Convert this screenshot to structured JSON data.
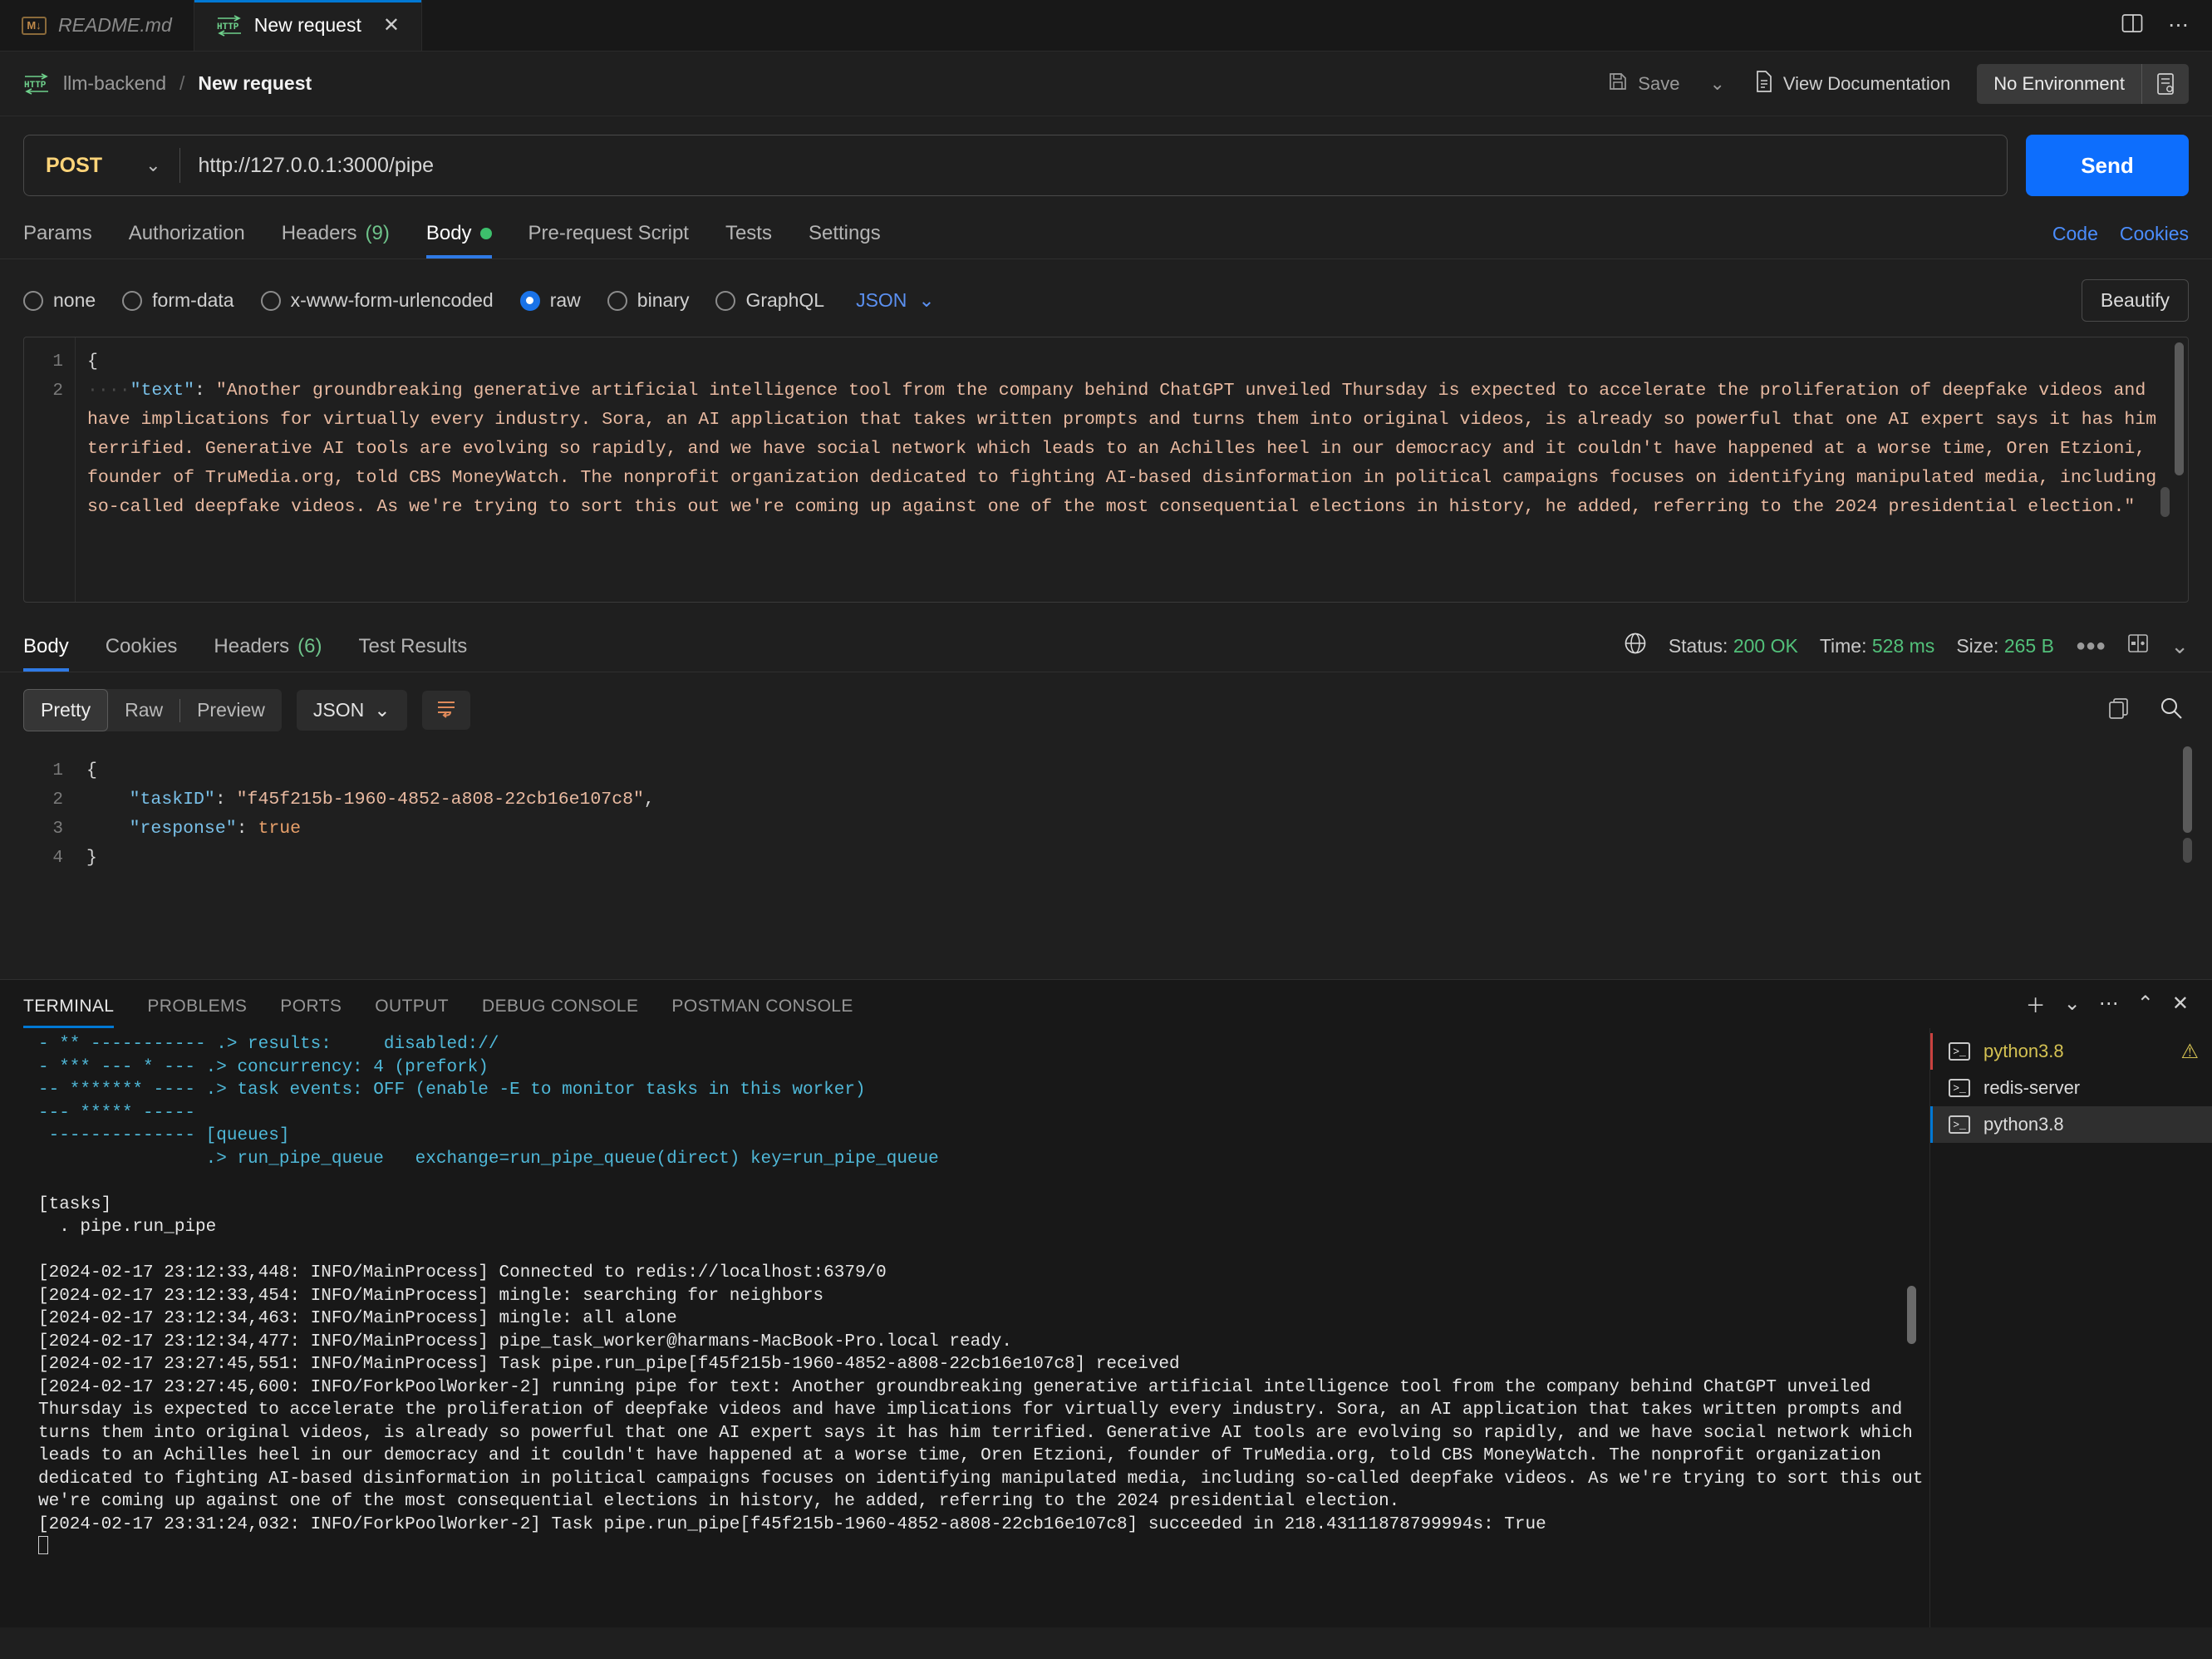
{
  "tabs": [
    {
      "label": "README.md",
      "icon": "markdown-icon",
      "active": false
    },
    {
      "label": "New request",
      "icon": "http-icon",
      "active": true,
      "close": "✕"
    }
  ],
  "titlebar_right": {
    "split_icon": "split-editor-icon",
    "more_icon": "ellipsis-icon"
  },
  "postman": {
    "breadcrumb": {
      "collection": "llm-backend",
      "separator": "/",
      "current": "New request",
      "icon": "http-icon"
    },
    "save_label": "Save",
    "save_chevron": "⌄",
    "view_docs_label": "View Documentation",
    "environment": "No Environment",
    "env_icon": "environment-quick-look-icon",
    "save_icon": "floppy-disk-icon",
    "docs_icon": "document-icon"
  },
  "request": {
    "method": "POST",
    "method_chevron": "⌄",
    "url": "http://127.0.0.1:3000/pipe",
    "send_label": "Send",
    "tabs": [
      {
        "label": "Params",
        "active": false
      },
      {
        "label": "Authorization",
        "active": false
      },
      {
        "label": "Headers",
        "count": "(9)",
        "active": false
      },
      {
        "label": "Body",
        "active": true,
        "dot": true
      },
      {
        "label": "Pre-request Script",
        "active": false
      },
      {
        "label": "Tests",
        "active": false
      },
      {
        "label": "Settings",
        "active": false
      }
    ],
    "right_links": [
      "Code",
      "Cookies"
    ],
    "body_types": [
      {
        "label": "none",
        "selected": false
      },
      {
        "label": "form-data",
        "selected": false
      },
      {
        "label": "x-www-form-urlencoded",
        "selected": false
      },
      {
        "label": "raw",
        "selected": true
      },
      {
        "label": "binary",
        "selected": false
      },
      {
        "label": "GraphQL",
        "selected": false
      }
    ],
    "raw_format": "JSON",
    "raw_format_chevron": "⌄",
    "beautify_label": "Beautify",
    "body_line_numbers": [
      "1",
      "2"
    ],
    "body_open_brace": "{",
    "body_indent": "····",
    "body_key": "\"text\"",
    "body_colon": ": ",
    "body_value": "\"Another groundbreaking generative artificial intelligence tool from the company behind ChatGPT unveiled Thursday is expected to accelerate the proliferation of deepfake videos and have implications for virtually every industry. Sora, an AI application that takes written prompts and turns them into original videos, is already so powerful that one AI expert says it has him terrified. Generative AI tools are evolving so rapidly, and we have social network which leads to an Achilles heel in our democracy and it couldn't have happened at a worse time, Oren Etzioni, founder of TruMedia.org, told CBS MoneyWatch. The nonprofit organization dedicated to fighting AI-based disinformation in political campaigns focuses on identifying manipulated media, including so-called deepfake videos. As we're trying to sort this out we're coming up against one of the most consequential elections in history, he added, referring to the 2024 presidential election.\""
  },
  "response": {
    "tabs": [
      {
        "label": "Body",
        "active": true
      },
      {
        "label": "Cookies",
        "active": false
      },
      {
        "label": "Headers",
        "count": "(6)",
        "active": false
      },
      {
        "label": "Test Results",
        "active": false
      }
    ],
    "globe_icon": "globe-icon",
    "status_label": "Status:",
    "status_value": "200 OK",
    "time_label": "Time:",
    "time_value": "528 ms",
    "size_label": "Size:",
    "size_value": "265 B",
    "more_icon": "ellipsis-icon",
    "layout_icon": "split-pane-icon",
    "collapse_icon": "chevron-down-icon",
    "view_modes": [
      "Pretty",
      "Raw",
      "Preview"
    ],
    "active_view_mode": "Pretty",
    "format": "JSON",
    "format_chevron": "⌄",
    "wrap_icon": "word-wrap-icon",
    "copy_icon": "copy-icon",
    "search_icon": "search-icon",
    "line_numbers": [
      "1",
      "2",
      "3",
      "4"
    ],
    "json": {
      "open": "{",
      "close": "}",
      "rows": [
        {
          "key": "\"taskID\"",
          "sep": ": ",
          "value": "\"f45f215b-1960-4852-a808-22cb16e107c8\"",
          "type": "string",
          "comma": ","
        },
        {
          "key": "\"response\"",
          "sep": ": ",
          "value": "true",
          "type": "bool",
          "comma": ""
        }
      ]
    }
  },
  "panel": {
    "tabs": [
      {
        "label": "TERMINAL",
        "active": true
      },
      {
        "label": "PROBLEMS",
        "active": false
      },
      {
        "label": "PORTS",
        "active": false
      },
      {
        "label": "OUTPUT",
        "active": false
      },
      {
        "label": "DEBUG CONSOLE",
        "active": false
      },
      {
        "label": "POSTMAN CONSOLE",
        "active": false
      }
    ],
    "actions": [
      {
        "icon": "add-terminal-icon",
        "glyph": "＋"
      },
      {
        "icon": "chevron-down-icon",
        "glyph": "⌄"
      },
      {
        "icon": "ellipsis-icon",
        "glyph": "⋯"
      },
      {
        "icon": "chevron-up-icon",
        "glyph": "⌃"
      },
      {
        "icon": "close-icon",
        "glyph": "✕"
      }
    ],
    "terminal_list": [
      {
        "name": "python3.8",
        "icon": "terminal-icon",
        "selected": false,
        "warning": true,
        "warn_glyph": "⚠"
      },
      {
        "name": "redis-server",
        "icon": "terminal-icon",
        "selected": false,
        "warning": false
      },
      {
        "name": "python3.8",
        "icon": "terminal-icon",
        "selected": true,
        "warning": false
      }
    ],
    "terminal_banner": [
      "- ** ----------- .> results:     disabled://",
      "- *** --- * --- .> concurrency: 4 (prefork)",
      "-- ******* ---- .> task events: OFF (enable -E to monitor tasks in this worker)",
      "--- ***** -----",
      " -------------- [queues]",
      "                .> run_pipe_queue   exchange=run_pipe_queue(direct) key=run_pipe_queue"
    ],
    "terminal_plain": [
      "",
      "[tasks]",
      "  . pipe.run_pipe",
      "",
      "[2024-02-17 23:12:33,448: INFO/MainProcess] Connected to redis://localhost:6379/0",
      "[2024-02-17 23:12:33,454: INFO/MainProcess] mingle: searching for neighbors",
      "[2024-02-17 23:12:34,463: INFO/MainProcess] mingle: all alone",
      "[2024-02-17 23:12:34,477: INFO/MainProcess] pipe_task_worker@harmans-MacBook-Pro.local ready.",
      "[2024-02-17 23:27:45,551: INFO/MainProcess] Task pipe.run_pipe[f45f215b-1960-4852-a808-22cb16e107c8] received",
      "[2024-02-17 23:27:45,600: INFO/ForkPoolWorker-2] running pipe for text: Another groundbreaking generative artificial intelligence tool from the company behind ChatGPT unveiled Thursday is expected to accelerate the proliferation of deepfake videos and have implications for virtually every industry. Sora, an AI application that takes written prompts and turns them into original videos, is already so powerful that one AI expert says it has him terrified. Generative AI tools are evolving so rapidly, and we have social network which leads to an Achilles heel in our democracy and it couldn't have happened at a worse time, Oren Etzioni, founder of TruMedia.org, told CBS MoneyWatch. The nonprofit organization dedicated to fighting AI-based disinformation in political campaigns focuses on identifying manipulated media, including so-called deepfake videos. As we're trying to sort this out we're coming up against one of the most consequential elections in history, he added, referring to the 2024 presidential election.",
      "[2024-02-17 23:31:24,032: INFO/ForkPoolWorker-2] Task pipe.run_pipe[f45f215b-1960-4852-a808-22cb16e107c8] succeeded in 218.43111878799994s: True"
    ]
  },
  "colors": {
    "accent_blue": "#0078d4",
    "send_blue": "#0d6efd",
    "status_green": "#52c17a",
    "terminal_cyan": "#4fb8d8",
    "warning_yellow": "#d4c152",
    "method_yellow": "#ffd479"
  }
}
